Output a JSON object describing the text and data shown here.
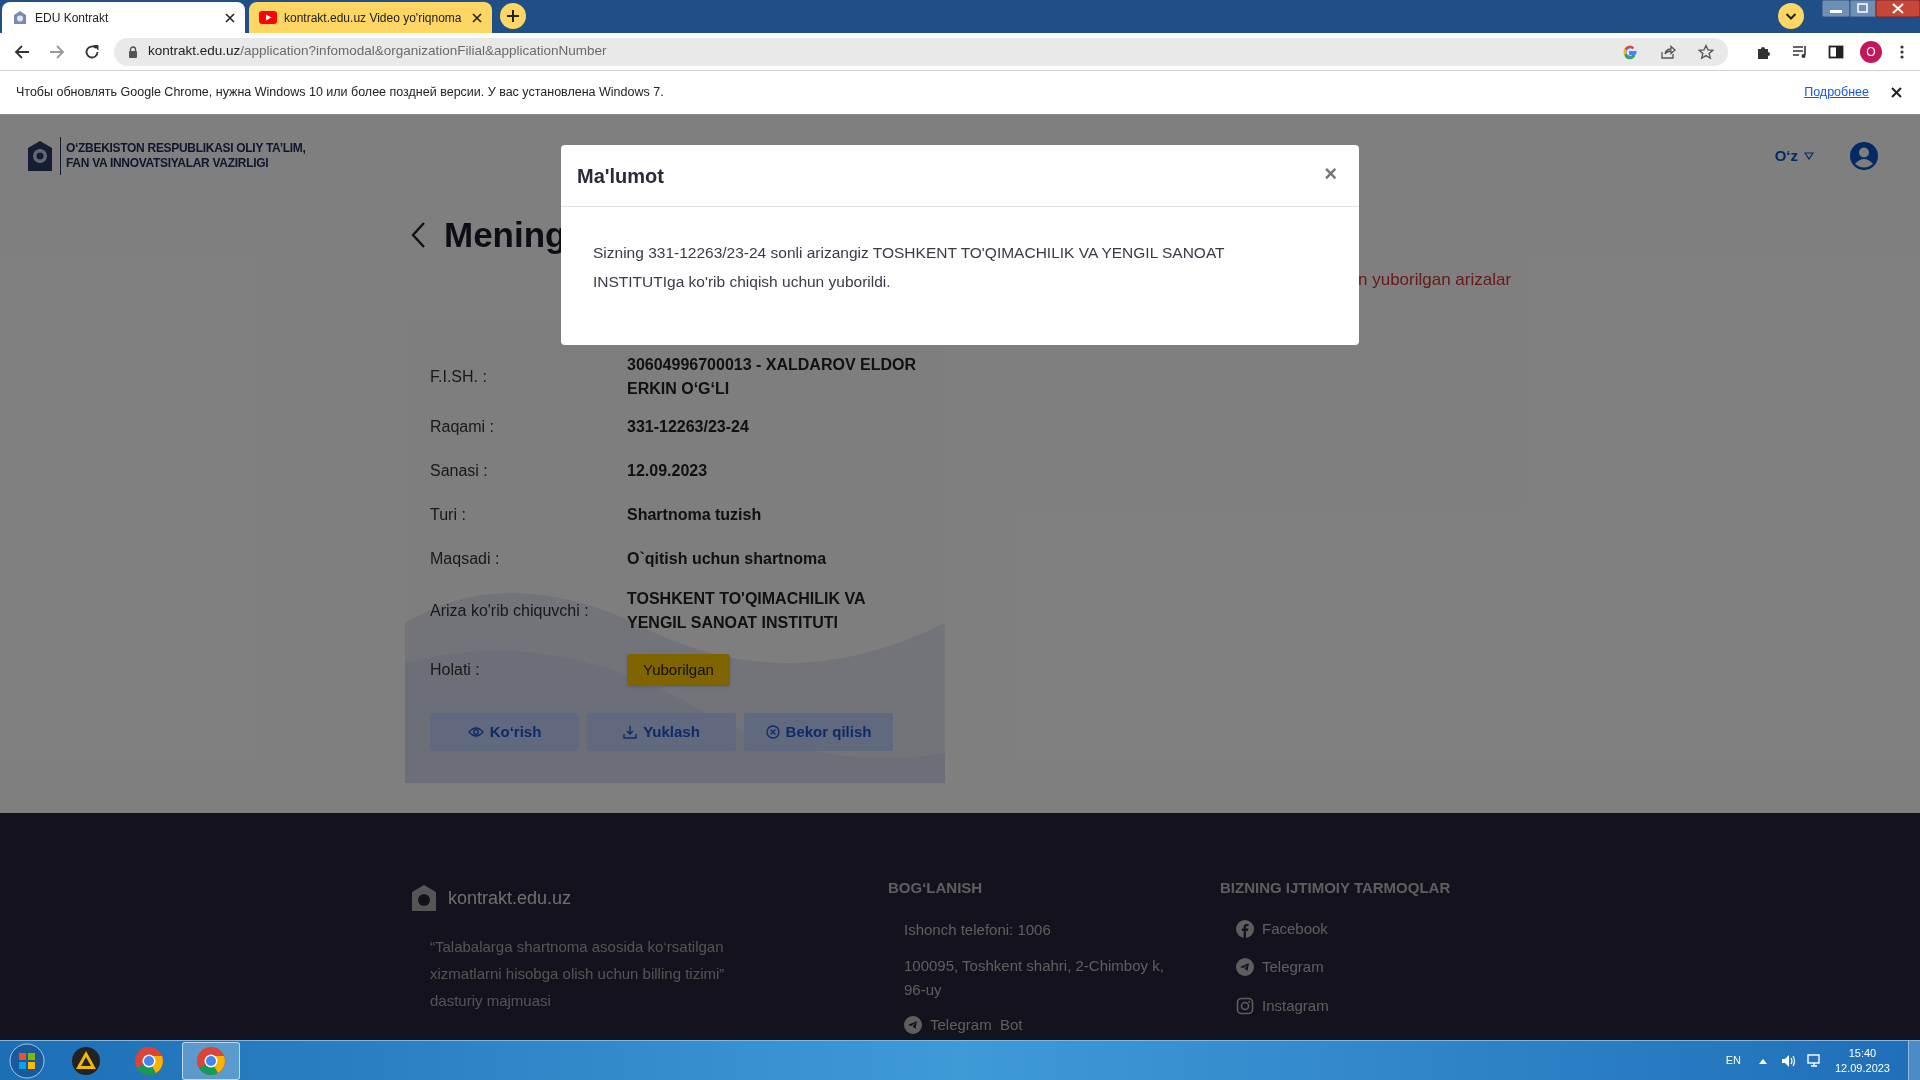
{
  "browser": {
    "tabs": [
      {
        "title": "EDU Kontrakt",
        "kind": "emblem",
        "selected": true
      },
      {
        "title": "kontrakt.edu.uz Video yo'riqnoma",
        "kind": "video",
        "selected": false
      }
    ],
    "url_host": "kontrakt.edu.uz",
    "url_path": "/application?infomodal&organizationFilial&applicationNumber",
    "profile": "O",
    "info_bar": {
      "message": "Чтобы обновлять Google Chrome, нужна Windows 10 или более поздней версии. У вас установлена Windows 7.",
      "link": "Подробнее"
    }
  },
  "header": {
    "ministry": [
      "O‘ZBEKISTON RESPUBLIKASI OLIY TA’LIM,",
      "FAN VA INNOVATSIYALAR VAZIRLIGI"
    ],
    "language": "O‘z"
  },
  "page_title": "Mening",
  "tab_link": "n yuborilgan arizalar",
  "card": {
    "rows": [
      {
        "label": "F.I.SH. :",
        "value": "30604996700013 - XALDAROV ELDOR ERKIN O‘G‘LI"
      },
      {
        "label": "Raqami :",
        "value": "331-12263/23-24"
      },
      {
        "label": "Sanasi :",
        "value": "12.09.2023"
      },
      {
        "label": "Turi :",
        "value": "Shartnoma tuzish"
      },
      {
        "label": "Maqsadi :",
        "value": "O`qitish uchun shartnoma"
      },
      {
        "label": "Ariza ko'rib chiquvchi :",
        "value": "TOSHKENT TO'QIMACHILIK VA YENGIL SANOAT INSTITUTI"
      }
    ],
    "status": {
      "label": "Holati :",
      "value": "Yuborilgan"
    },
    "buttons": [
      {
        "label": "Ko‘rish",
        "kind": "eye"
      },
      {
        "label": "Yuklash",
        "kind": "download"
      },
      {
        "label": "Bekor qilish",
        "kind": "cancel"
      }
    ]
  },
  "modal": {
    "title": "Ma'lumot",
    "close": "×",
    "message": "Sizning 331-12263/23-24 sonli arizangiz TOSHKENT TO'QIMACHILIK VA YENGIL SANOAT INSTITUTIga ko'rib chiqish uchun yuborildi."
  },
  "footer": {
    "site": "kontrakt.edu.uz",
    "quote": "“Talabalarga shartnoma asosida ko‘rsatilgan xizmatlarni hisobga olish uchun billing tizimi” dasturiy majmuasi",
    "contact_title": "BOG‘LANISH",
    "contacts": [
      {
        "text": "Ishonch telefoni: 1006",
        "kind": "text"
      },
      {
        "text": "100095, Toshkent shahri, 2-Chimboy k, 96-uy",
        "kind": "text"
      },
      {
        "text": "Telegram  Bot",
        "kind": "telegram"
      }
    ],
    "social_title": "BIZNING IJTIMOIY TARMOQLAR",
    "socials": [
      {
        "text": "Facebook",
        "kind": "facebook"
      },
      {
        "text": "Telegram",
        "kind": "telegram"
      },
      {
        "text": "Instagram",
        "kind": "instagram"
      }
    ]
  },
  "taskbar": {
    "language": "EN",
    "time": "15:40",
    "date": "12.09.2023"
  }
}
